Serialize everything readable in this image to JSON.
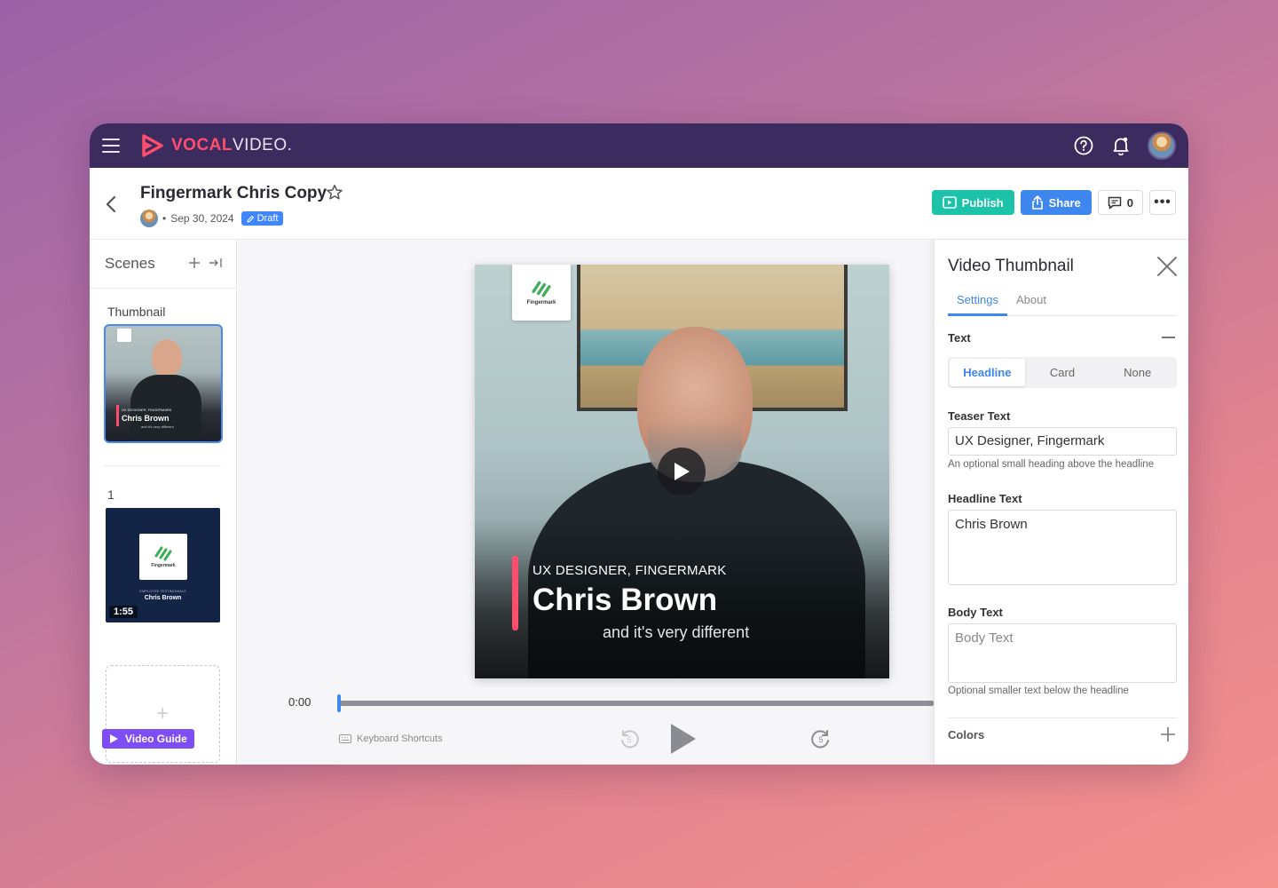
{
  "app": {
    "logo_vocal": "VOCAL",
    "logo_video": "VIDEO."
  },
  "header": {
    "title": "Fingermark Chris Copy",
    "date": "Sep 30, 2024",
    "bullet": "•",
    "status": "Draft",
    "publish_label": "Publish",
    "share_label": "Share",
    "comments_count": "0",
    "more_label": "•••"
  },
  "scenes": {
    "heading": "Scenes",
    "thumbnail_label": "Thumbnail",
    "thumb_teaser": "UX DESIGNER, FINGERMARK",
    "thumb_name": "Chris Brown",
    "thumb_body": "and it's very different",
    "scene1_label": "1",
    "scene1_logo_text": "Fingermark",
    "scene1_sub1": "EMPLOYEE TESTIMONIALS",
    "scene1_sub2": "Chris Brown",
    "scene1_duration": "1:55",
    "add_plus": "+",
    "video_guide_label": "Video Guide"
  },
  "stage": {
    "logo_text": "Fingermark",
    "teaser": "UX DESIGNER, FINGERMARK",
    "headline": "Chris Brown",
    "body": "and it's very different",
    "time": "0:00",
    "progress": 0,
    "keyboard_shortcuts": "Keyboard Shortcuts",
    "rewind_seconds": "5",
    "forward_seconds": "5"
  },
  "panel": {
    "title": "Video Thumbnail",
    "tabs": [
      {
        "label": "Settings",
        "active": true
      },
      {
        "label": "About",
        "active": false
      }
    ],
    "text_section": "Text",
    "text_options": [
      "Headline",
      "Card",
      "None"
    ],
    "text_selected": "Headline",
    "teaser_label": "Teaser Text",
    "teaser_value": "UX Designer, Fingermark",
    "teaser_help": "An optional small heading above the headline",
    "headline_label": "Headline Text",
    "headline_value": "Chris Brown",
    "body_label": "Body Text",
    "body_placeholder": "Body Text",
    "body_help": "Optional smaller text below the headline",
    "colors_section": "Colors"
  },
  "colors": {
    "nav_bg": "#3c2b5e",
    "accent_red": "#ff4d6d",
    "publish_green": "#1cc3a8",
    "share_blue": "#3d87ee",
    "guide_purple": "#7d4ef5"
  }
}
